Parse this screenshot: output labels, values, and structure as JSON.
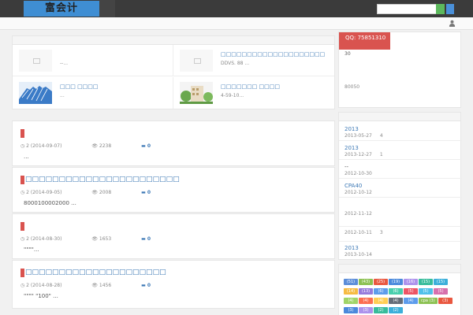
{
  "header": {
    "logo": "富会计"
  },
  "featured": [
    {
      "title": "",
      "desc": "--...",
      "has_image": false
    },
    {
      "title": "□□□□□□□□□□□□□□□□□□□□",
      "desc": "DDVS. 88 ...",
      "has_image": false
    },
    {
      "title": "□□□ □□□□",
      "desc": "...",
      "has_image": true,
      "image": "blue-balls"
    },
    {
      "title": "□□□□□□□ □□□□",
      "desc": "4-59-10...",
      "has_image": true,
      "image": "building"
    }
  ],
  "posts": [
    {
      "title": "",
      "date": "2 (2014-09-07)",
      "views": "2238",
      "comments": "0",
      "excerpt": "..."
    },
    {
      "title": "□□□□□□□□□□□□□□□□□□□□□□□",
      "date": "2 (2014-09-05)",
      "views": "2008",
      "comments": "0",
      "excerpt": "8000100002000 ..."
    },
    {
      "title": "",
      "date": "2 (2014-08-30)",
      "views": "1653",
      "comments": "0",
      "excerpt": "\"\"\"\"..."
    },
    {
      "title": "□□□□□□□□□□□□□□□□□□□□□",
      "date": "2 (2014-08-28)",
      "views": "1456",
      "comments": "0",
      "excerpt": "\"\"\"\" \"100\" ..."
    }
  ],
  "sidebar": {
    "qq": {
      "badge": "QQ: 75851310",
      "line1": "30",
      "line2": "80050"
    },
    "list": [
      {
        "title": "2013",
        "date": "2013-05-27",
        "count": "4"
      },
      {
        "title": "2013",
        "date": "2013-12-27",
        "count": "1"
      },
      {
        "title": "--",
        "date": "2012-10-30",
        "count": ""
      },
      {
        "title": "CPA40",
        "date": "2012-10-12",
        "count": ""
      },
      {
        "title": "",
        "date": "2012-11-12",
        "count": ""
      },
      {
        "title": "",
        "date": "2012-10-11",
        "count": "3"
      },
      {
        "title": "2013",
        "date": "2013-10-14",
        "count": ""
      }
    ],
    "tags": [
      {
        "label": "(51)",
        "color": "#5b8dd9"
      },
      {
        "label": "(43)",
        "color": "#8cc152"
      },
      {
        "label": "(25)",
        "color": "#e9573f"
      },
      {
        "label": "(19)",
        "color": "#4a89dc"
      },
      {
        "label": "(16)",
        "color": "#ac92ec"
      },
      {
        "label": "(15)",
        "color": "#37bc9b"
      },
      {
        "label": "(15)",
        "color": "#3bafda"
      },
      {
        "label": "(14)",
        "color": "#f6bb42"
      },
      {
        "label": "(13)",
        "color": "#967adc"
      },
      {
        "label": "(6)",
        "color": "#5d9cec"
      },
      {
        "label": "(6)",
        "color": "#48cfad"
      },
      {
        "label": "(5)",
        "color": "#ed5565"
      },
      {
        "label": "(5)",
        "color": "#4fc1e9"
      },
      {
        "label": "(5)",
        "color": "#d770ad"
      },
      {
        "label": "(4)",
        "color": "#a0d468"
      },
      {
        "label": "(4)",
        "color": "#fc6e51"
      },
      {
        "label": "(4)",
        "color": "#ffce54"
      },
      {
        "label": "(4)",
        "color": "#656d78"
      },
      {
        "label": "(4)",
        "color": "#5d9cec"
      },
      {
        "label": "cpa (3)",
        "color": "#8cc152"
      },
      {
        "label": "(3)",
        "color": "#e9573f"
      },
      {
        "label": "(3)",
        "color": "#4a89dc"
      },
      {
        "label": "(3)",
        "color": "#ac92ec"
      },
      {
        "label": "(2)",
        "color": "#37bc9b"
      },
      {
        "label": "(2)",
        "color": "#3bafda"
      }
    ]
  }
}
